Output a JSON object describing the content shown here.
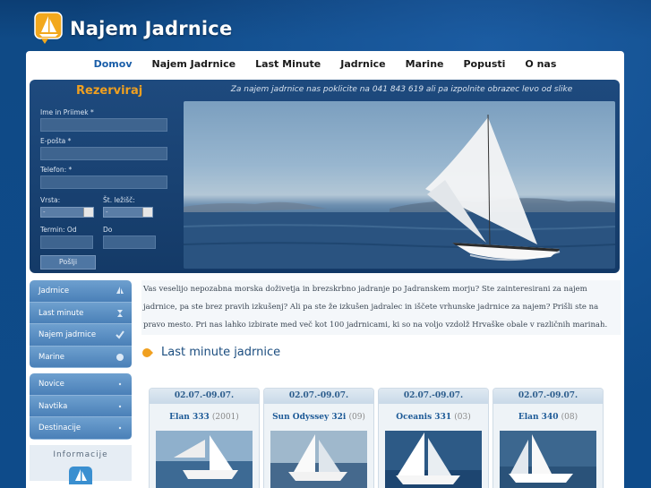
{
  "brand": {
    "name": "Najem Jadrnice",
    "accent": "#f0a020"
  },
  "nav": [
    "Domov",
    "Najem Jadrnice",
    "Last Minute",
    "Jadrnice",
    "Marine",
    "Popusti",
    "O nas"
  ],
  "reservation": {
    "title": "Rezerviraj",
    "name_label": "Ime in Priimek *",
    "email_label": "E-pošta *",
    "phone_label": "Telefon: *",
    "type_label": "Vrsta:",
    "berths_label": "Št. ležišč:",
    "type_value": "-",
    "berths_value": "-",
    "from_label": "Termin: Od",
    "to_label": "Do",
    "submit_label": "Pošlji"
  },
  "hero_phone_text": "Za najem jadrnice nas poklicite na 041 843 619 ali pa izpolnite obrazec levo od slike",
  "sidebar": {
    "group1": [
      {
        "label": "Jadrnice",
        "icon": "sailboat-icon"
      },
      {
        "label": "Last minute",
        "icon": "hourglass-icon"
      },
      {
        "label": "Najem jadrnice",
        "icon": "check-icon"
      },
      {
        "label": "Marine",
        "icon": "circle-icon"
      }
    ],
    "group2": [
      {
        "label": "Novice",
        "icon": "dot-icon"
      },
      {
        "label": "Navtika",
        "icon": "dot-icon"
      },
      {
        "label": "Destinacije",
        "icon": "dot-icon"
      }
    ],
    "info_title": "Informacije"
  },
  "intro_text": "Vas veselijo nepozabna morska doživetja in brezskrbno jadranje po Jadranskem morju? Ste zainteresirani za najem jadrnice, pa ste brez pravih izkušenj? Ali pa ste že izkušen jadralec in iščete vrhunske jadrnice za najem? Prišli ste na pravo mesto. Pri nas lahko izbirate med več kot 100 jadrnicami, ki so na voljo vzdolž Hrvaške obale v različnih marinah.",
  "last_minute": {
    "title": "Last minute jadrnice",
    "cards": [
      {
        "date": "02.07.-09.07.",
        "name": "Elan 333",
        "year": "(2001)"
      },
      {
        "date": "02.07.-09.07.",
        "name": "Sun Odyssey 32i",
        "year": "(09)"
      },
      {
        "date": "02.07.-09.07.",
        "name": "Oceanis 331",
        "year": "(03)"
      },
      {
        "date": "02.07.-09.07.",
        "name": "Elan 340",
        "year": "(08)"
      }
    ]
  }
}
